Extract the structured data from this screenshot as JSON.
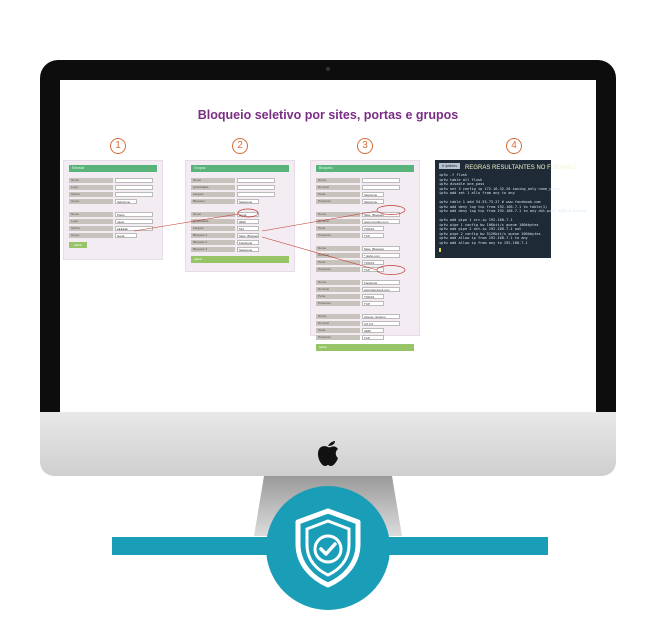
{
  "headline": "Bloqueio seletivo por sites, portas e grupos",
  "steps": [
    "1",
    "2",
    "3",
    "4"
  ],
  "panel1": {
    "header": "Entrada",
    "rows1": [
      {
        "label": "Nome",
        "value": ""
      },
      {
        "label": "Login",
        "value": ""
      },
      {
        "label": "Senha",
        "value": ""
      },
      {
        "label": "Grupo",
        "value": "Selecione"
      }
    ],
    "rows2": [
      {
        "label": "Nome",
        "value": "Paulo"
      },
      {
        "label": "Login",
        "value": "paulo"
      },
      {
        "label": "Senha",
        "value": "●●●●●●"
      },
      {
        "label": "Grupo",
        "value": "Geral"
      }
    ],
    "button": "salvar"
  },
  "panel2": {
    "header": "Grupos",
    "rows1": [
      {
        "label": "Nome",
        "value": ""
      },
      {
        "label": "Quantidade",
        "value": ""
      },
      {
        "label": "Largura",
        "value": ""
      },
      {
        "label": "Bloqueio",
        "value": "Selecione"
      }
    ],
    "rows2": [
      {
        "label": "Nome",
        "value": "Geral"
      },
      {
        "label": "Quantidade",
        "value": "9999"
      },
      {
        "label": "Largura",
        "value": "512"
      },
      {
        "label": "Bloqueio 1",
        "value": "Sites_Bloqueio"
      },
      {
        "label": "Bloqueio 2",
        "value": "Facebook"
      },
      {
        "label": "Bloqueio 3",
        "value": "Selecione"
      }
    ],
    "footer": "salvar"
  },
  "panel3": {
    "header": "Bloqueio",
    "block1": [
      {
        "label": "Nome",
        "value": ""
      },
      {
        "label": "Domínio",
        "value": ""
      },
      {
        "label": "Porta",
        "value": "Selecione"
      },
      {
        "label": "Protocolo",
        "value": "Selecione"
      }
    ],
    "block2": [
      {
        "label": "Nome",
        "value": "Sites_Bloqueio"
      },
      {
        "label": "Domínio",
        "value": "www.youtube.com"
      },
      {
        "label": "Porta",
        "value": "TODAS"
      },
      {
        "label": "Protocolo",
        "value": "TCP"
      }
    ],
    "block3": [
      {
        "label": "Nome",
        "value": "Sites_Bloqueio"
      },
      {
        "label": "Domínio",
        "value": "*.globo.com"
      },
      {
        "label": "Porta",
        "value": "TODAS"
      },
      {
        "label": "Protocolo",
        "value": "TCP"
      }
    ],
    "block4": [
      {
        "label": "Nome",
        "value": "Facebook"
      },
      {
        "label": "Domínio",
        "value": "www.facebook.com"
      },
      {
        "label": "Porta",
        "value": "TODAS"
      },
      {
        "label": "Protocolo",
        "value": "TCP"
      }
    ],
    "block5": [
      {
        "label": "Nome",
        "value": "Acesso_Externo"
      },
      {
        "label": "Domínio",
        "value": "0.0.0.0"
      },
      {
        "label": "Porta",
        "value": "3389"
      },
      {
        "label": "Protocolo",
        "value": "TCP"
      }
    ],
    "footer": "salvar"
  },
  "terminal": {
    "badge": "# iptables",
    "title": "REGRAS RESULTANTES NO FIREWALL",
    "lines": [
      "ipfw -f flush",
      "ipfw table all flush",
      "ipfw disable one_pass",
      "ipfw set 3 config ip 172.16.32.20 saving_only none_ports",
      "ipfw add set 1 allo from any to any",
      "",
      "ipfw table 1 add 34.53.73.27 # www.facebook.com",
      "ipfw add deny log tcp from 192.168.7.1 to table(1)",
      "ipfw add deny log tcp from 192.168.7.1 to any dst-port 3389 # Acesso",
      "",
      "ipfw add pipe 1 src-ip 192.168.7.1",
      "ipfw pipe 1 config bw 10Kbit/s queue 100kbytes",
      "ipfw add pipe 2 dst-ip 192.168.7.1 out",
      "ipfw pipe 2 config bw 512Kbit/s queue 100kbytes",
      "ipfw add allow ip from 192.168.7.1 to any",
      "ipfw add allow ip from any to 192.168.7.1"
    ]
  },
  "colors": {
    "accent": "#7b2d86",
    "step": "#d76b38",
    "header": "#5ab37a",
    "button": "#96c467",
    "brand": "#1a9db7"
  }
}
